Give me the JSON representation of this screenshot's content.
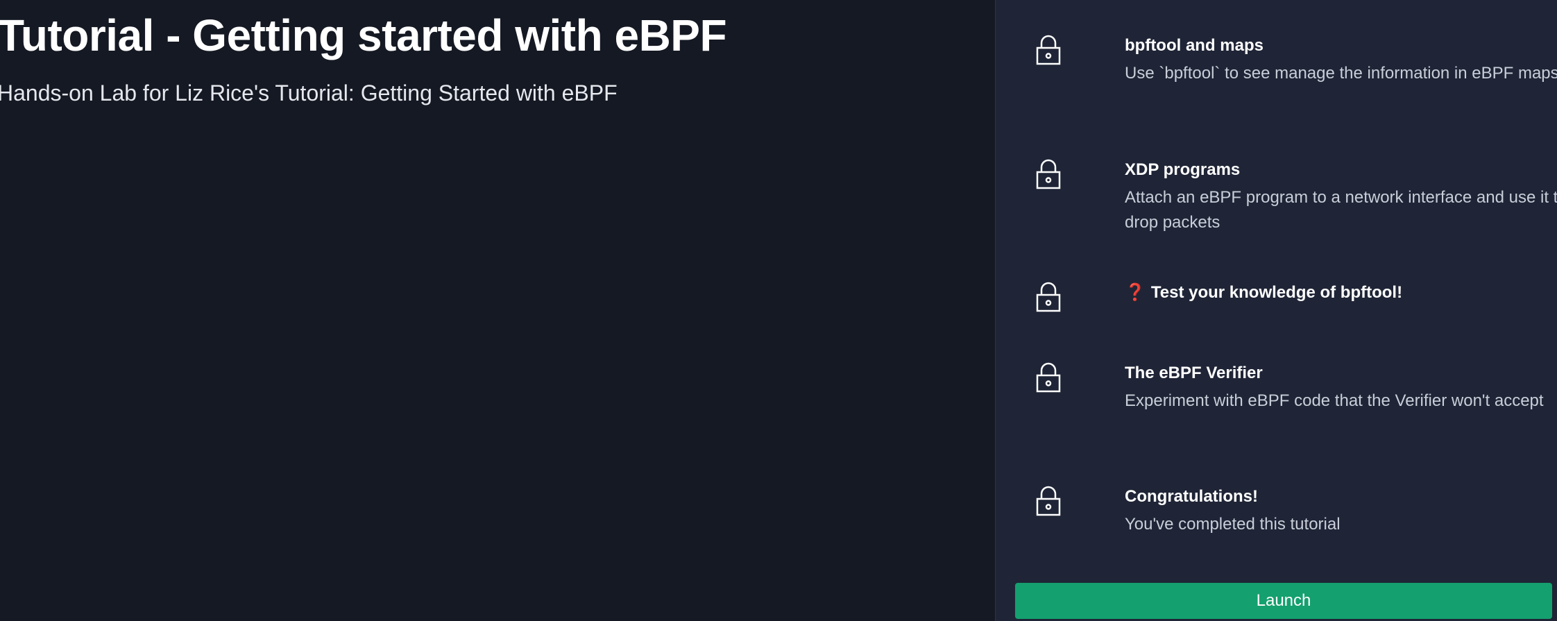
{
  "header": {
    "title": "Tutorial - Getting started with eBPF",
    "subtitle": "Hands-on Lab for Liz Rice's Tutorial: Getting Started with eBPF"
  },
  "steps": [
    {
      "icon": "lock-icon",
      "title": "bpftool and maps",
      "description": "Use `bpftool` to see manage the information in eBPF maps"
    },
    {
      "icon": "lock-icon",
      "title": "XDP programs",
      "description": "Attach an eBPF program to a network interface and use it to drop packets"
    },
    {
      "icon": "lock-icon",
      "prefix": "❓",
      "title": "Test your knowledge of bpftool!",
      "description": ""
    },
    {
      "icon": "lock-icon",
      "title": "The eBPF Verifier",
      "description": "Experiment with eBPF code that the Verifier won't accept"
    },
    {
      "icon": "lock-icon",
      "title": "Congratulations!",
      "description": "You've completed this tutorial"
    }
  ],
  "launch_label": "Launch",
  "colors": {
    "background": "#151923",
    "panel": "#1f2536",
    "accent": "#14a06f",
    "question_mark": "#e5484d"
  }
}
